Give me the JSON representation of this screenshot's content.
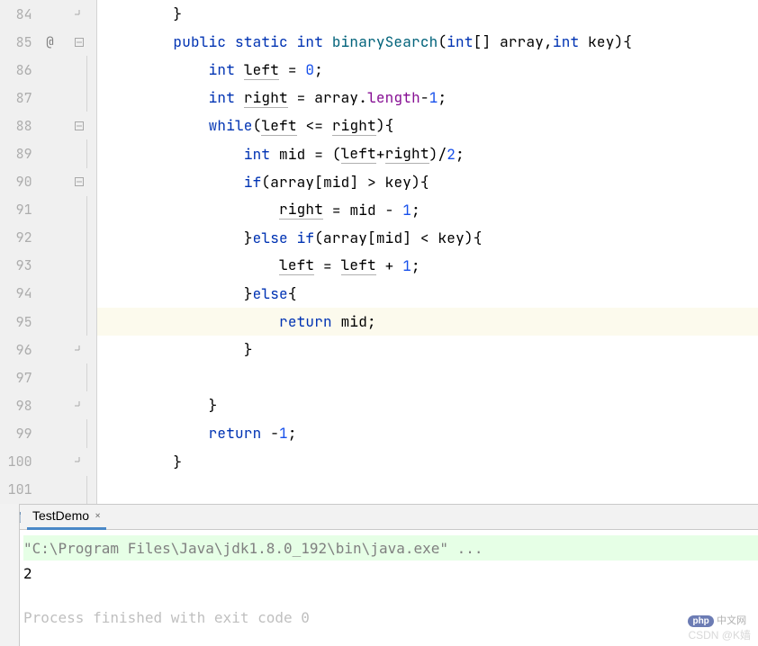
{
  "editor": {
    "lines": [
      {
        "num": "84",
        "fold": "close",
        "indent": 2,
        "tokens": [
          {
            "t": "plain",
            "v": "}"
          }
        ]
      },
      {
        "num": "85",
        "ann": "@",
        "fold": "open",
        "indent": 2,
        "tokens": [
          {
            "t": "kw",
            "v": "public "
          },
          {
            "t": "kw",
            "v": "static "
          },
          {
            "t": "kw",
            "v": "int "
          },
          {
            "t": "fn",
            "v": "binarySearch"
          },
          {
            "t": "plain",
            "v": "("
          },
          {
            "t": "kw",
            "v": "int"
          },
          {
            "t": "plain",
            "v": "[] "
          },
          {
            "t": "var",
            "v": "array"
          },
          {
            "t": "plain",
            "v": ","
          },
          {
            "t": "kw",
            "v": "int "
          },
          {
            "t": "var",
            "v": "key"
          },
          {
            "t": "plain",
            "v": "){"
          }
        ]
      },
      {
        "num": "86",
        "fold": "line",
        "indent": 3,
        "tokens": [
          {
            "t": "kw",
            "v": "int "
          },
          {
            "t": "var ul",
            "v": "left"
          },
          {
            "t": "plain",
            "v": " = "
          },
          {
            "t": "num",
            "v": "0"
          },
          {
            "t": "plain",
            "v": ";"
          }
        ]
      },
      {
        "num": "87",
        "fold": "line",
        "indent": 3,
        "tokens": [
          {
            "t": "kw",
            "v": "int "
          },
          {
            "t": "var ul",
            "v": "right"
          },
          {
            "t": "plain",
            "v": " = "
          },
          {
            "t": "var",
            "v": "array"
          },
          {
            "t": "plain",
            "v": "."
          },
          {
            "t": "fld",
            "v": "length"
          },
          {
            "t": "plain",
            "v": "-"
          },
          {
            "t": "num",
            "v": "1"
          },
          {
            "t": "plain",
            "v": ";"
          }
        ]
      },
      {
        "num": "88",
        "fold": "open",
        "indent": 3,
        "tokens": [
          {
            "t": "kw",
            "v": "while"
          },
          {
            "t": "plain",
            "v": "("
          },
          {
            "t": "var ul",
            "v": "left"
          },
          {
            "t": "plain",
            "v": " <= "
          },
          {
            "t": "var ul",
            "v": "right"
          },
          {
            "t": "plain",
            "v": "){"
          }
        ]
      },
      {
        "num": "89",
        "fold": "line",
        "indent": 4,
        "tokens": [
          {
            "t": "kw",
            "v": "int "
          },
          {
            "t": "var",
            "v": "mid"
          },
          {
            "t": "plain",
            "v": " = ("
          },
          {
            "t": "var ul",
            "v": "left"
          },
          {
            "t": "plain",
            "v": "+"
          },
          {
            "t": "var ul",
            "v": "right"
          },
          {
            "t": "plain",
            "v": ")/"
          },
          {
            "t": "num",
            "v": "2"
          },
          {
            "t": "plain",
            "v": ";"
          }
        ]
      },
      {
        "num": "90",
        "fold": "open",
        "indent": 4,
        "tokens": [
          {
            "t": "kw",
            "v": "if"
          },
          {
            "t": "plain",
            "v": "("
          },
          {
            "t": "var",
            "v": "array"
          },
          {
            "t": "plain",
            "v": "["
          },
          {
            "t": "var",
            "v": "mid"
          },
          {
            "t": "plain",
            "v": "] > "
          },
          {
            "t": "var",
            "v": "key"
          },
          {
            "t": "plain",
            "v": "){"
          }
        ]
      },
      {
        "num": "91",
        "fold": "line",
        "indent": 5,
        "tokens": [
          {
            "t": "var ul",
            "v": "right"
          },
          {
            "t": "plain",
            "v": " = "
          },
          {
            "t": "var",
            "v": "mid"
          },
          {
            "t": "plain",
            "v": " - "
          },
          {
            "t": "num",
            "v": "1"
          },
          {
            "t": "plain",
            "v": ";"
          }
        ]
      },
      {
        "num": "92",
        "fold": "line",
        "indent": 4,
        "tokens": [
          {
            "t": "plain",
            "v": "}"
          },
          {
            "t": "kw",
            "v": "else if"
          },
          {
            "t": "plain",
            "v": "("
          },
          {
            "t": "var",
            "v": "array"
          },
          {
            "t": "plain",
            "v": "["
          },
          {
            "t": "var",
            "v": "mid"
          },
          {
            "t": "plain",
            "v": "] < "
          },
          {
            "t": "var",
            "v": "key"
          },
          {
            "t": "plain",
            "v": "){"
          }
        ]
      },
      {
        "num": "93",
        "fold": "line",
        "indent": 5,
        "tokens": [
          {
            "t": "var ul",
            "v": "left"
          },
          {
            "t": "plain",
            "v": " = "
          },
          {
            "t": "var ul",
            "v": "left"
          },
          {
            "t": "plain",
            "v": " + "
          },
          {
            "t": "num",
            "v": "1"
          },
          {
            "t": "plain",
            "v": ";"
          }
        ]
      },
      {
        "num": "94",
        "fold": "line",
        "indent": 4,
        "tokens": [
          {
            "t": "plain",
            "v": "}"
          },
          {
            "t": "kw",
            "v": "else"
          },
          {
            "t": "plain",
            "v": "{"
          }
        ]
      },
      {
        "num": "95",
        "fold": "line",
        "indent": 5,
        "highlight": true,
        "tokens": [
          {
            "t": "kw",
            "v": "return "
          },
          {
            "t": "var",
            "v": "mid"
          },
          {
            "t": "plain",
            "v": ";"
          }
        ]
      },
      {
        "num": "96",
        "fold": "close",
        "indent": 4,
        "tokens": [
          {
            "t": "plain",
            "v": "}"
          }
        ]
      },
      {
        "num": "97",
        "fold": "line",
        "indent": 0,
        "tokens": []
      },
      {
        "num": "98",
        "fold": "close",
        "indent": 3,
        "tokens": [
          {
            "t": "plain",
            "v": "}"
          }
        ]
      },
      {
        "num": "99",
        "fold": "line",
        "indent": 3,
        "tokens": [
          {
            "t": "kw",
            "v": "return "
          },
          {
            "t": "plain",
            "v": "-"
          },
          {
            "t": "num",
            "v": "1"
          },
          {
            "t": "plain",
            "v": ";"
          }
        ]
      },
      {
        "num": "100",
        "fold": "close",
        "indent": 2,
        "tokens": [
          {
            "t": "plain",
            "v": "}"
          }
        ]
      },
      {
        "num": "101",
        "fold": "line",
        "indent": 0,
        "tokens": []
      }
    ]
  },
  "tab": {
    "label": "TestDemo",
    "close": "×"
  },
  "console": {
    "cmd": "\"C:\\Program Files\\Java\\jdk1.8.0_192\\bin\\java.exe\" ...",
    "out": "2",
    "exit": "Process finished with exit code 0"
  },
  "watermark": {
    "php": "php",
    "cn": "中文网",
    "csdn": "CSDN @K嫱"
  }
}
